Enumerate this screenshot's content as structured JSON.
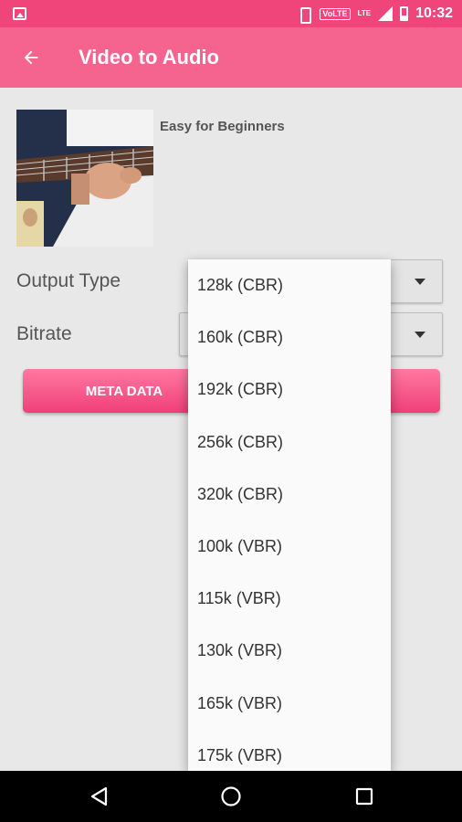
{
  "status_bar": {
    "time": "10:32",
    "volte": "VoLTE",
    "lte": "LTE",
    "icons": [
      "image-icon",
      "vibrate-icon",
      "signal-icon",
      "battery-icon"
    ]
  },
  "toolbar": {
    "title": "Video to Audio",
    "back_icon": "arrow-back-icon"
  },
  "video": {
    "title": "Easy for Beginners"
  },
  "form": {
    "output_type_label": "Output Type",
    "bitrate_label": "Bitrate"
  },
  "buttons": {
    "meta_data": "META DATA"
  },
  "dropdown": {
    "items": [
      "128k (CBR)",
      "160k (CBR)",
      "192k (CBR)",
      "256k (CBR)",
      "320k (CBR)",
      "100k (VBR)",
      "115k (VBR)",
      "130k (VBR)",
      "165k (VBR)",
      "175k (VBR)"
    ]
  },
  "colors": {
    "status_bar": "#f0457a",
    "toolbar": "#f5638f",
    "accent": "#f03f78",
    "background": "#e8e8e8"
  }
}
